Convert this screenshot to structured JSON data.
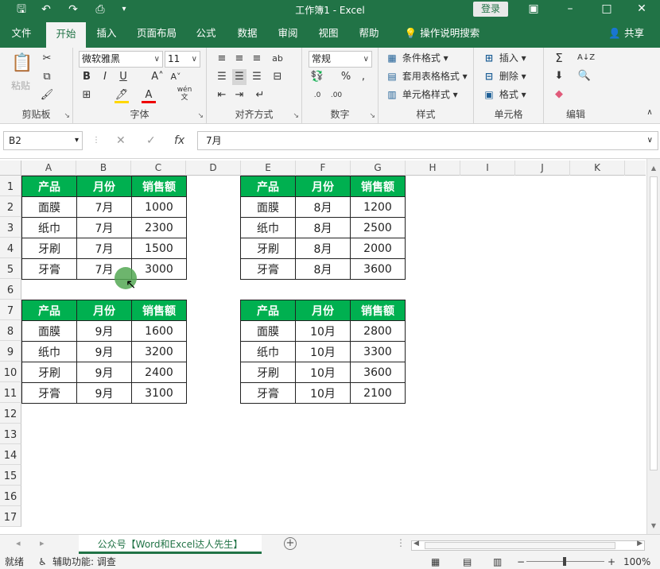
{
  "window": {
    "title": "工作簿1  -  Excel",
    "login": "登录"
  },
  "tabs": [
    "文件",
    "开始",
    "插入",
    "页面布局",
    "公式",
    "数据",
    "审阅",
    "视图",
    "帮助"
  ],
  "tell_me": "操作说明搜索",
  "share": "共享",
  "ribbon": {
    "clipboard": {
      "label": "剪贴板",
      "paste": "粘贴"
    },
    "font": {
      "label": "字体",
      "name": "微软雅黑",
      "size": "11",
      "wen": "wén\n文"
    },
    "alignment": {
      "label": "对齐方式"
    },
    "number": {
      "label": "数字",
      "format": "常规"
    },
    "styles": {
      "label": "样式",
      "conditional": "条件格式",
      "table": "套用表格格式",
      "cell_styles": "单元格样式"
    },
    "cells": {
      "label": "单元格",
      "insert": "插入",
      "delete": "删除",
      "format": "格式"
    },
    "editing": {
      "label": "编辑"
    }
  },
  "formula_bar": {
    "name_box": "B2",
    "content": "7月",
    "fx": "fx"
  },
  "columns": [
    "A",
    "B",
    "C",
    "D",
    "E",
    "F",
    "G",
    "H",
    "I",
    "J",
    "K"
  ],
  "rows": [
    "1",
    "2",
    "3",
    "4",
    "5",
    "6",
    "7",
    "8",
    "9",
    "10",
    "11",
    "12",
    "13",
    "14",
    "15",
    "16",
    "17"
  ],
  "tables": [
    {
      "headers": [
        "产品",
        "月份",
        "销售额"
      ],
      "rows": [
        [
          "面膜",
          "7月",
          "1000"
        ],
        [
          "纸巾",
          "7月",
          "2300"
        ],
        [
          "牙刷",
          "7月",
          "1500"
        ],
        [
          "牙膏",
          "7月",
          "3000"
        ]
      ]
    },
    {
      "headers": [
        "产品",
        "月份",
        "销售额"
      ],
      "rows": [
        [
          "面膜",
          "8月",
          "1200"
        ],
        [
          "纸巾",
          "8月",
          "2500"
        ],
        [
          "牙刷",
          "8月",
          "2000"
        ],
        [
          "牙膏",
          "8月",
          "3600"
        ]
      ]
    },
    {
      "headers": [
        "产品",
        "月份",
        "销售额"
      ],
      "rows": [
        [
          "面膜",
          "9月",
          "1600"
        ],
        [
          "纸巾",
          "9月",
          "3200"
        ],
        [
          "牙刷",
          "9月",
          "2400"
        ],
        [
          "牙膏",
          "9月",
          "3100"
        ]
      ]
    },
    {
      "headers": [
        "产品",
        "月份",
        "销售额"
      ],
      "rows": [
        [
          "面膜",
          "10月",
          "2800"
        ],
        [
          "纸巾",
          "10月",
          "3300"
        ],
        [
          "牙刷",
          "10月",
          "3600"
        ],
        [
          "牙膏",
          "10月",
          "2100"
        ]
      ]
    }
  ],
  "sheet_tab": "公众号【Word和Excel达人先生】",
  "status": {
    "mode": "就绪",
    "accessibility": "辅助功能: 调查",
    "zoom": "100%"
  },
  "colors": {
    "excel_green": "#217346",
    "header_fill": "#00b050"
  }
}
